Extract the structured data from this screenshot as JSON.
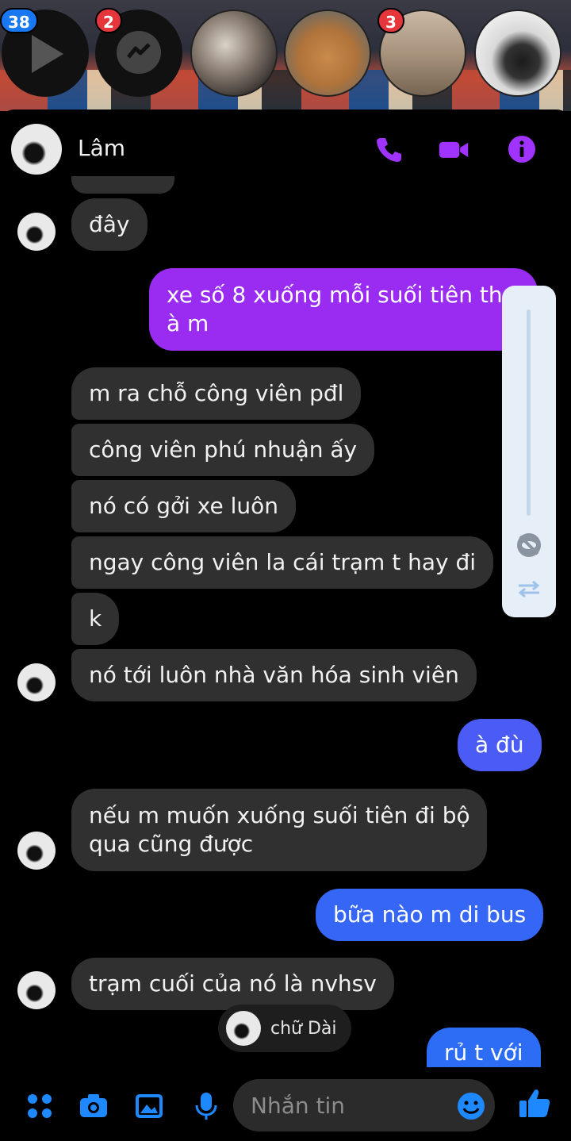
{
  "chat_heads": {
    "video_badge": "38",
    "messenger_badge": "2",
    "photo3_badge": "3"
  },
  "header": {
    "name": "Lâm"
  },
  "messages": [
    {
      "dir": "in",
      "text": "đây"
    },
    {
      "dir": "out",
      "text": "xe số 8 xuống mỗi suối tiên thoi",
      "text2": "à m"
    },
    {
      "dir": "in",
      "text": "m ra chỗ công viên pđl"
    },
    {
      "dir": "in",
      "text": "công viên phú nhuận ấy"
    },
    {
      "dir": "in",
      "text": "nó có gởi xe luôn"
    },
    {
      "dir": "in",
      "text": "ngay công viên la cái trạm t hay đi"
    },
    {
      "dir": "in",
      "text": "k"
    },
    {
      "dir": "in",
      "text": "nó tới luôn nhà văn hóa sinh viên"
    },
    {
      "dir": "out",
      "text": "à đù"
    },
    {
      "dir": "in",
      "text": "nếu m muốn xuống suối tiên đi bộ",
      "text2": "qua cũng được"
    },
    {
      "dir": "out",
      "text": "bữa nào m di bus"
    },
    {
      "dir": "in",
      "text": "trạm cuối của nó là nvhsv"
    },
    {
      "dir": "out",
      "text": "rủ t với"
    }
  ],
  "seen_chip": {
    "label": "chữ Dài"
  },
  "composer": {
    "placeholder": "Nhắn tin"
  },
  "colors": {
    "accent": "#a033ff",
    "bubble_in": "#303030",
    "out_top": "#9a2cf2",
    "out_mid": "#4a5cf5",
    "out_bottom": "#2d6df6"
  }
}
